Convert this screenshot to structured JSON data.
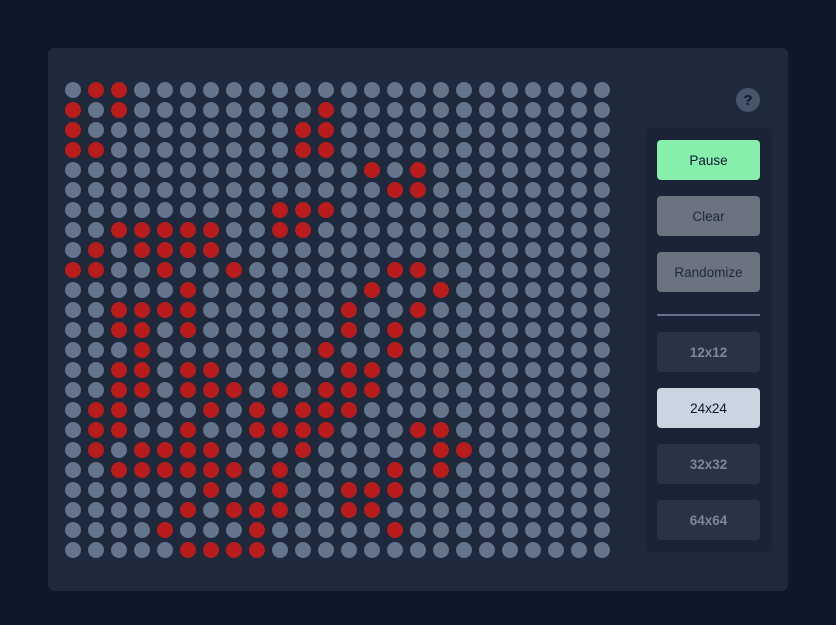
{
  "controls": {
    "pause_label": "Pause",
    "clear_label": "Clear",
    "randomize_label": "Randomize",
    "help_label": "?"
  },
  "grid_sizes": [
    "12x12",
    "24x24",
    "32x32",
    "64x64"
  ],
  "selected_size": "24x24",
  "board": {
    "cols": 24,
    "rows": 24,
    "alive_cells": [
      [
        0,
        1
      ],
      [
        0,
        2
      ],
      [
        1,
        0
      ],
      [
        1,
        2
      ],
      [
        1,
        11
      ],
      [
        2,
        0
      ],
      [
        2,
        10
      ],
      [
        2,
        11
      ],
      [
        3,
        0
      ],
      [
        3,
        1
      ],
      [
        3,
        10
      ],
      [
        3,
        11
      ],
      [
        4,
        13
      ],
      [
        4,
        15
      ],
      [
        5,
        14
      ],
      [
        5,
        15
      ],
      [
        6,
        9
      ],
      [
        6,
        10
      ],
      [
        6,
        11
      ],
      [
        7,
        2
      ],
      [
        7,
        3
      ],
      [
        7,
        4
      ],
      [
        7,
        5
      ],
      [
        7,
        6
      ],
      [
        7,
        9
      ],
      [
        7,
        10
      ],
      [
        8,
        1
      ],
      [
        8,
        3
      ],
      [
        8,
        4
      ],
      [
        8,
        5
      ],
      [
        8,
        6
      ],
      [
        9,
        0
      ],
      [
        9,
        1
      ],
      [
        9,
        4
      ],
      [
        9,
        7
      ],
      [
        9,
        14
      ],
      [
        9,
        15
      ],
      [
        10,
        5
      ],
      [
        10,
        13
      ],
      [
        10,
        16
      ],
      [
        11,
        2
      ],
      [
        11,
        3
      ],
      [
        11,
        4
      ],
      [
        11,
        5
      ],
      [
        11,
        12
      ],
      [
        11,
        15
      ],
      [
        12,
        2
      ],
      [
        12,
        3
      ],
      [
        12,
        5
      ],
      [
        12,
        12
      ],
      [
        12,
        14
      ],
      [
        13,
        3
      ],
      [
        13,
        11
      ],
      [
        13,
        14
      ],
      [
        14,
        2
      ],
      [
        14,
        3
      ],
      [
        14,
        5
      ],
      [
        14,
        6
      ],
      [
        14,
        12
      ],
      [
        14,
        13
      ],
      [
        15,
        2
      ],
      [
        15,
        3
      ],
      [
        15,
        5
      ],
      [
        15,
        6
      ],
      [
        15,
        7
      ],
      [
        15,
        9
      ],
      [
        15,
        11
      ],
      [
        15,
        12
      ],
      [
        15,
        13
      ],
      [
        16,
        1
      ],
      [
        16,
        2
      ],
      [
        16,
        6
      ],
      [
        16,
        8
      ],
      [
        16,
        10
      ],
      [
        16,
        11
      ],
      [
        16,
        12
      ],
      [
        17,
        1
      ],
      [
        17,
        2
      ],
      [
        17,
        5
      ],
      [
        17,
        8
      ],
      [
        17,
        9
      ],
      [
        17,
        10
      ],
      [
        17,
        11
      ],
      [
        17,
        15
      ],
      [
        17,
        16
      ],
      [
        18,
        1
      ],
      [
        18,
        3
      ],
      [
        18,
        4
      ],
      [
        18,
        5
      ],
      [
        18,
        6
      ],
      [
        18,
        10
      ],
      [
        18,
        16
      ],
      [
        18,
        17
      ],
      [
        19,
        2
      ],
      [
        19,
        3
      ],
      [
        19,
        4
      ],
      [
        19,
        5
      ],
      [
        19,
        6
      ],
      [
        19,
        7
      ],
      [
        19,
        9
      ],
      [
        19,
        14
      ],
      [
        19,
        16
      ],
      [
        20,
        6
      ],
      [
        20,
        9
      ],
      [
        20,
        12
      ],
      [
        20,
        13
      ],
      [
        20,
        14
      ],
      [
        21,
        5
      ],
      [
        21,
        7
      ],
      [
        21,
        8
      ],
      [
        21,
        9
      ],
      [
        21,
        12
      ],
      [
        21,
        13
      ],
      [
        22,
        4
      ],
      [
        22,
        8
      ],
      [
        22,
        14
      ],
      [
        23,
        5
      ],
      [
        23,
        6
      ],
      [
        23,
        7
      ],
      [
        23,
        8
      ]
    ]
  },
  "colors": {
    "page_background": "#0f172a",
    "card_background": "#1e293b",
    "alive_cell": "#b91c1c",
    "dead_cell": "#64748b",
    "pause_button": "#86efac",
    "secondary_button": "#6b7280",
    "size_button": "#283445",
    "size_button_active": "#cbd5e1"
  }
}
